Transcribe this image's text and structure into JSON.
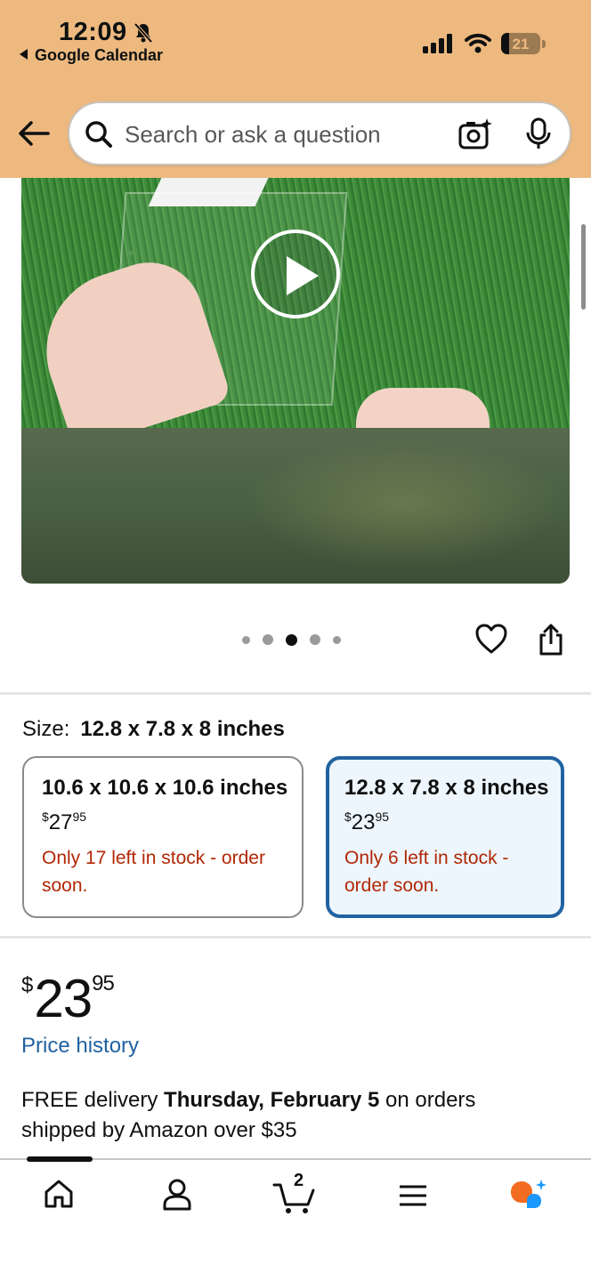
{
  "status_bar": {
    "time": "12:09",
    "back_app": "Google Calendar",
    "battery": "21"
  },
  "search": {
    "placeholder": "Search or ask a question"
  },
  "media": {
    "dots_count": 5,
    "active_dot": 3
  },
  "size": {
    "label": "Size:",
    "selected": "12.8 x 7.8 x 8 inches",
    "options": [
      {
        "name": "10.6 x 10.6 x 10.6 inches",
        "price_currency": "$",
        "price_whole": "27",
        "price_cents": "95",
        "stock": "Only 17 left in stock - order soon.",
        "selected": false
      },
      {
        "name": "12.8 x 7.8 x 8 inches",
        "price_currency": "$",
        "price_whole": "23",
        "price_cents": "95",
        "stock": "Only 6 left in stock - order soon.",
        "selected": true
      }
    ]
  },
  "price": {
    "currency": "$",
    "whole": "23",
    "cents": "95",
    "history_link": "Price history"
  },
  "delivery": {
    "prefix": "FREE delivery ",
    "date": "Thursday, February 5",
    "suffix": " on orders shipped by Amazon over $35"
  },
  "bottom_nav": {
    "cart_count": "2",
    "items": [
      "home-icon",
      "account-icon",
      "cart-icon",
      "menu-icon",
      "rufus-ai-icon"
    ]
  },
  "colors": {
    "header_bg": "#edb97f",
    "link": "#2162a1",
    "stock_warning": "#b12704",
    "selected_border": "#2162a1",
    "selected_bg": "#edf6fd"
  }
}
